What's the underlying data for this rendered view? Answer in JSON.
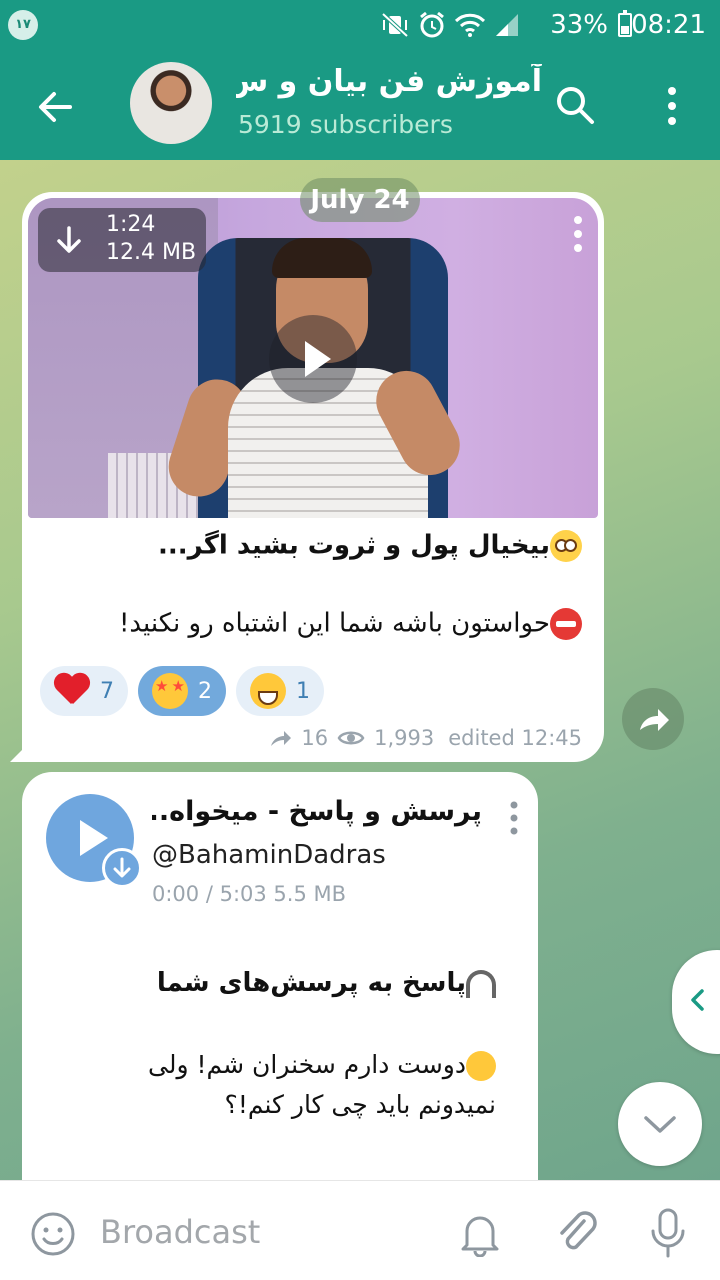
{
  "status_bar": {
    "badge": "۱۷",
    "battery": "33%",
    "time": "08:21"
  },
  "header": {
    "title": "آموزش فن بیان و س...",
    "subscribers": "5919 subscribers"
  },
  "chat": {
    "date": "July 24",
    "post1": {
      "duration": "1:24",
      "size": "12.4 MB",
      "title": "بیخیال پول و ثروت بشید اگر...",
      "line": "حواستون باشه شما این اشتباه رو نکنید!",
      "reactions": [
        {
          "emoji": "heart-icon",
          "count": "7"
        },
        {
          "emoji": "star-struck-icon",
          "count": "2"
        },
        {
          "emoji": "grin-icon",
          "count": "1"
        }
      ],
      "shares": "16",
      "views": "1,993",
      "edited": "edited 12:45"
    },
    "post2": {
      "audio_title": "پرسش و پاسخ - میخواه...",
      "audio_handle": "@BahaminDadras",
      "audio_info": "0:00 / 5:03  5.5 MB",
      "title": "پاسخ به پرسش‌های شما",
      "line1": "دوست دارم سخنران شم! ولی",
      "line2": "نمیدونم باید چی کار کنم!؟"
    }
  },
  "input": {
    "placeholder": "Broadcast"
  },
  "colors": {
    "header": "#1a9a84",
    "accent": "#6fa6de",
    "subtitle": "#b9ead6"
  }
}
